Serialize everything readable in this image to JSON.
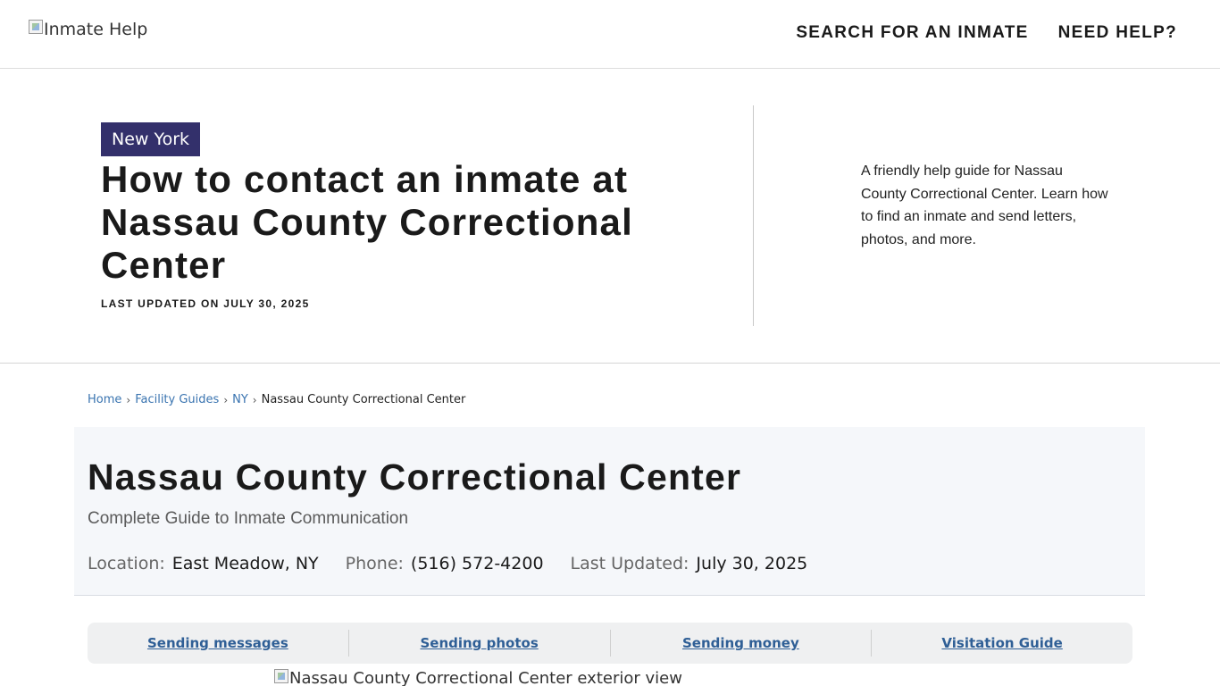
{
  "header": {
    "logo_alt": "Inmate Help",
    "nav": {
      "search": "SEARCH FOR AN INMATE",
      "help": "NEED HELP?"
    }
  },
  "hero": {
    "state_tag": "New York",
    "title": "How to contact an inmate at Nassau County Correctional Center",
    "updated": "LAST UPDATED ON JULY 30, 2025",
    "description": "A friendly help guide for Nassau County Correctional Center. Learn how to find an inmate and send letters, photos, and more."
  },
  "breadcrumb": {
    "items": [
      "Home",
      "Facility Guides",
      "NY",
      "Nassau County Correctional Center"
    ],
    "separator": "›"
  },
  "facility": {
    "title": "Nassau County Correctional Center",
    "subtitle": "Complete Guide to Inmate Communication",
    "location_label": "Location:",
    "location_value": "East Meadow, NY",
    "phone_label": "Phone:",
    "phone_value": "(516) 572-4200",
    "updated_label": "Last Updated:",
    "updated_value": "July 30, 2025"
  },
  "section_tabs": [
    "Sending messages",
    "Sending photos",
    "Sending money",
    "Visitation Guide"
  ],
  "exterior_image_alt": "Nassau County Correctional Center exterior view"
}
